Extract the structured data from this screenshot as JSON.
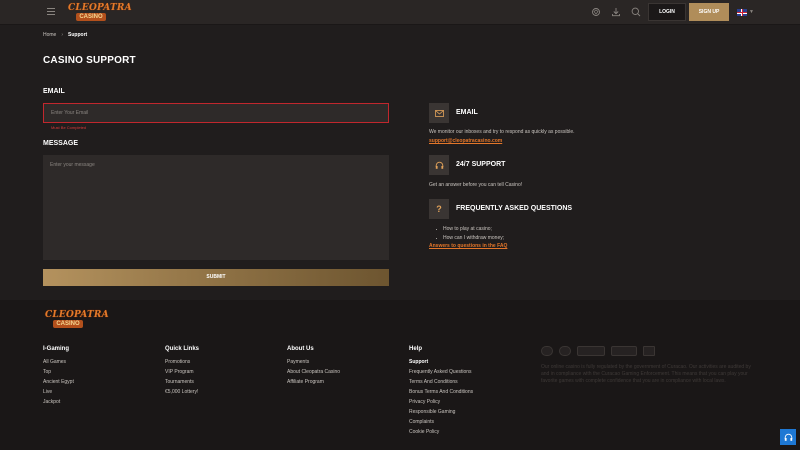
{
  "header": {
    "logo_top": "CLEOPATRA",
    "logo_bottom": "CASINO",
    "login_label": "LOGIN",
    "signup_label": "SIGN UP"
  },
  "breadcrumb": {
    "home": "Home",
    "current": "Support"
  },
  "page_title": "CASINO SUPPORT",
  "form": {
    "email_label": "EMAIL",
    "email_placeholder": "Enter Your Email",
    "email_error": "Must Be Completed",
    "message_label": "MESSAGE",
    "message_placeholder": "Enter your message",
    "submit_label": "SUBMIT"
  },
  "contact": {
    "email_title": "EMAIL",
    "email_text": "We monitor our inboxes and try to respond as quickly as possible.",
    "email_link": "support@cleopatracasino.com",
    "support_title": "24/7 SUPPORT",
    "support_text": "Get an answer before you can tell Casino!",
    "faq_title": "FREQUENTLY ASKED QUESTIONS",
    "faq_items": [
      "How to play at casino;",
      "How can I withdraw money;"
    ],
    "faq_link": "Answers to questions in the FAQ"
  },
  "footer": {
    "logo_top": "CLEOPATRA",
    "logo_bottom": "CASINO",
    "columns": [
      {
        "title": "I-Gaming",
        "items": [
          "All Games",
          "Top",
          "Ancient Egypt",
          "Live",
          "Jackpot"
        ]
      },
      {
        "title": "Quick Links",
        "items": [
          "Promotions",
          "VIP Program",
          "Tournaments",
          "€5,000 Lottery!"
        ]
      },
      {
        "title": "About Us",
        "items": [
          "Payments",
          "About Cleopatra Casino",
          "Affiliate Program"
        ]
      },
      {
        "title": "Help",
        "items": [
          "Support",
          "Frequently Asked Questions",
          "Terms And Conditions",
          "Bonus Terms And Conditions",
          "Privacy Policy",
          "Responsible Gaming",
          "Complaints",
          "Cookie Policy"
        ]
      }
    ],
    "license_text": "Our online casino is fully regulated by the government of Curacao. Our activities are audited by and in compliance with the Curacao Gaming Enforcement. This means that you can play your favorite games with complete confidence that you are in compliance with local laws."
  },
  "colors": {
    "accent_gold": "#b08d5a",
    "accent_orange": "#e3762a",
    "error_red": "#c1272d",
    "chat_blue": "#1e78d4"
  },
  "icons": {
    "menu": "hamburger-icon",
    "gift": "diamond-icon",
    "download": "download-icon",
    "search": "search-icon",
    "mail": "envelope-icon",
    "support": "headset-icon",
    "faq": "question-mark-icon",
    "chat": "headset-icon"
  }
}
